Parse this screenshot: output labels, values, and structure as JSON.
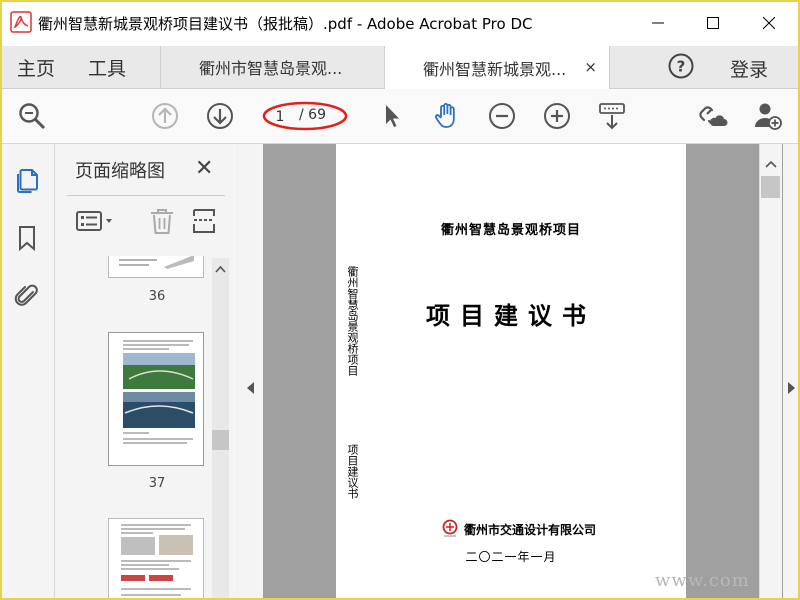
{
  "window": {
    "title": "衢州智慧新城景观桥项目建议书（报批稿）.pdf - Adobe Acrobat Pro DC",
    "minimize_icon": "minimize-icon",
    "maximize_icon": "maximize-icon",
    "close_icon": "close-icon"
  },
  "nav": {
    "home": "主页",
    "tools": "工具",
    "tabs": [
      {
        "label": "衢州市智慧岛景观...",
        "active": false
      },
      {
        "label": "衢州智慧新城景观...",
        "active": true,
        "close": "×"
      }
    ],
    "login": "登录"
  },
  "toolbar": {
    "page_current": "1",
    "page_total": "/ 69"
  },
  "panel": {
    "title": "页面缩略图",
    "close": "✕",
    "thumbnails": [
      {
        "label": "36"
      },
      {
        "label": "37"
      },
      {
        "label": ""
      }
    ]
  },
  "document": {
    "header_small": "衢州智慧岛景观桥项目",
    "header_big": "项目建议书",
    "side_vertical_1": "衢州智慧岛景观桥项目",
    "side_vertical_2": "项目建议书",
    "company": "衢州市交通设计有限公司",
    "date": "二〇二一年一月"
  },
  "colors": {
    "accent_blue": "#2c6fc1",
    "highlight_red": "#e0201a",
    "frame_yellow": "#e6d34a"
  }
}
